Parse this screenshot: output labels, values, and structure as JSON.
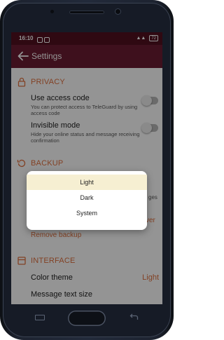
{
  "status_bar": {
    "time": "16:10",
    "battery": "72"
  },
  "toolbar": {
    "title": "Settings"
  },
  "privacy": {
    "header": "PRIVACY",
    "access_code_title": "Use access code",
    "access_code_sub": "You can protect access to TeleGuard by using access code",
    "invisible_title": "Invisible mode",
    "invisible_sub": "Hide your online status and message receiving confirmation"
  },
  "backup": {
    "header": "BACKUP",
    "peek_right_1": "ges",
    "peek_right_2": "ver",
    "remove_label": "Remove backup"
  },
  "interface": {
    "header": "INTERFACE",
    "color_theme_label": "Color theme",
    "color_theme_value": "Light",
    "text_size_label": "Message text size"
  },
  "theme_dialog": {
    "options": [
      "Light",
      "Dark",
      "System"
    ],
    "selected": "Light"
  },
  "colors": {
    "status_bar": "#52101f",
    "toolbar": "#6c1d32",
    "accent": "#e0713f",
    "selected_option": "#f6efd2"
  },
  "icons": [
    "back-arrow-icon",
    "lock-icon",
    "backup-icon",
    "interface-icon"
  ]
}
